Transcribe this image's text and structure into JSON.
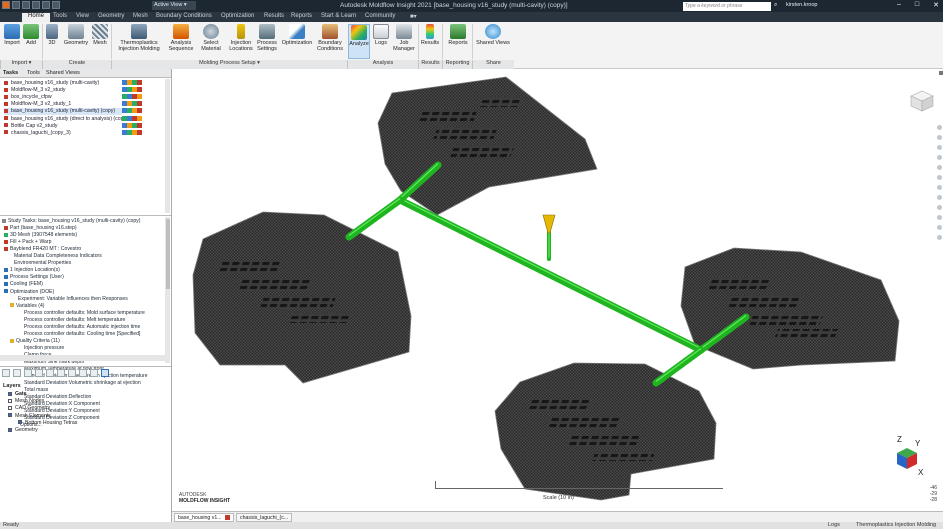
{
  "titlebar": {
    "title": "Autodesk Moldflow Insight 2021   [base_housing v16_study (multi-cavity) (copy)]",
    "view_dropdown": "Active View",
    "search_placeholder": "Type a keyword or phrase",
    "user": "kirsten.kroop"
  },
  "menu": {
    "tabs": [
      "Home",
      "Tools",
      "View",
      "Geometry",
      "Mesh",
      "Boundary Conditions",
      "Optimization",
      "Results",
      "Reports",
      "Start & Learn",
      "Community"
    ],
    "active": "Home"
  },
  "ribbon": {
    "buttons": {
      "import": "Import",
      "add": "Add",
      "view3d": "3D",
      "geometry": "Geometry",
      "mesh": "Mesh",
      "thermoplastics": "Thermoplastics Injection Molding",
      "analysis_sequence": "Analysis Sequence",
      "select_material": "Select Material",
      "injection_locations": "Injection Locations",
      "process_settings": "Process Settings",
      "optimization": "Optimization",
      "boundary_conditions": "Boundary Conditions",
      "analyze": "Analyze",
      "logs": "Logs",
      "job_manager": "Job Manager",
      "results": "Results",
      "reports": "Reports",
      "shared_views": "Shared Views"
    },
    "groups": [
      "Import",
      "Create",
      "Molding Process Setup",
      "Analysis",
      "Results",
      "Reporting",
      "Share"
    ]
  },
  "panel": {
    "tabs": [
      "Tasks",
      "Tools",
      "Shared Views"
    ],
    "studies": [
      "base_housing v16_study (multi-cavity)",
      "Moldflow-M_3 v2_study",
      "box_incycle_cfpw",
      "Moldflow-M_3 v2_study_1",
      "base_housing v16_study (multi-cavity) (copy)",
      "base_housing v16_study (direct to analysis) (copy)",
      "Bottle Cap v2_study",
      "chassis_laguchi_(copy_3)"
    ],
    "study_tasks": [
      "Study Tasks: base_housing v16_study (multi-cavity) (copy)",
      "Part (base_housing v16.step)",
      "3D Mesh (3907548 elements)",
      "Fill + Pack + Warp",
      "Bayblend FR420 MT : Covestro",
      "Material Data Completeness Indicators",
      "Environmental Properties",
      "1 Injection Location(s)",
      "Process Settings (User)",
      "Cooling (FEM)",
      "Optimization (DOE)",
      "Experiment: Variable Influences then Responses",
      "Variables (4)",
      "Process controller defaults: Mold surface temperature",
      "Process controller defaults: Melt temperature",
      "Process controller defaults: Automatic injection time",
      "Process controller defaults: Cooling time [Specified]",
      "Quality Criteria (11)",
      "Injection pressure",
      "Clamp force",
      "Maximum Sink mark depth",
      "Maximum Temperature at flow front",
      "Standard Deviation:Time to reach ejection temperature",
      "Standard Deviation:Volumetric shrinkage at ejection",
      "Total mass",
      "Standard Deviation:Deflection",
      "Standard Deviation:X Component",
      "Standard Deviation:Y Component",
      "Standard Deviation:Z Component",
      "Options..."
    ],
    "layers_title": "Layers",
    "layers": [
      "Gate",
      "Mesh Nodes",
      "CAD Geometry",
      "Mesh Elements",
      "Bottom Housing Tetras",
      "Geometry"
    ]
  },
  "viewport": {
    "brand_line1": "AUTODESK",
    "brand_line2": "MOLDFLOW  INSIGHT",
    "scale_label": "Scale (10 in)",
    "coords": [
      "-46",
      "-29",
      "-28"
    ],
    "axes": [
      "Z",
      "Y",
      "X"
    ]
  },
  "doctabs": [
    "base_housing v1...",
    "chassis_laguchi_(c..."
  ],
  "status": {
    "left": "Ready",
    "logs": "Logs",
    "mode": "Thermoplastics Injection Molding"
  },
  "colors": {
    "runner": "#1fb51f",
    "part": "#2b2b2b",
    "gate": "#e6b800",
    "titlebar": "#1d2731"
  }
}
